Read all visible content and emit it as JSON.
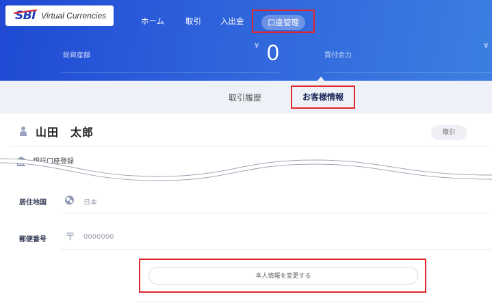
{
  "header": {
    "logo_main": "SBI",
    "logo_sub": "Virtual Currencies",
    "nav": [
      {
        "label": "ホーム",
        "active": false
      },
      {
        "label": "取引",
        "active": false
      },
      {
        "label": "入出金",
        "active": false
      },
      {
        "label": "口座管理",
        "active": true
      }
    ],
    "total_assets_label": "総資産額",
    "total_assets_currency": "¥",
    "total_assets_value": "0",
    "buying_power_label": "買付余力",
    "buying_power_currency": "¥"
  },
  "subtabs": [
    {
      "label": "取引履歴",
      "active": false
    },
    {
      "label": "お客様情報",
      "active": true
    }
  ],
  "profile": {
    "name": "山田　太郎",
    "trade_button": "取引",
    "bank_label": "銀行口座登録",
    "residence_label": "居住地国",
    "residence_value": "日本",
    "postal_label": "郵便番号",
    "postal_symbol": "〒",
    "postal_value": "0000000",
    "edit_button": "本人情報を変更する"
  },
  "colors": {
    "header_start": "#1f49d3",
    "header_end": "#3b7fe0",
    "highlight": "#e0262b",
    "tab_bg": "#eef1f7"
  }
}
